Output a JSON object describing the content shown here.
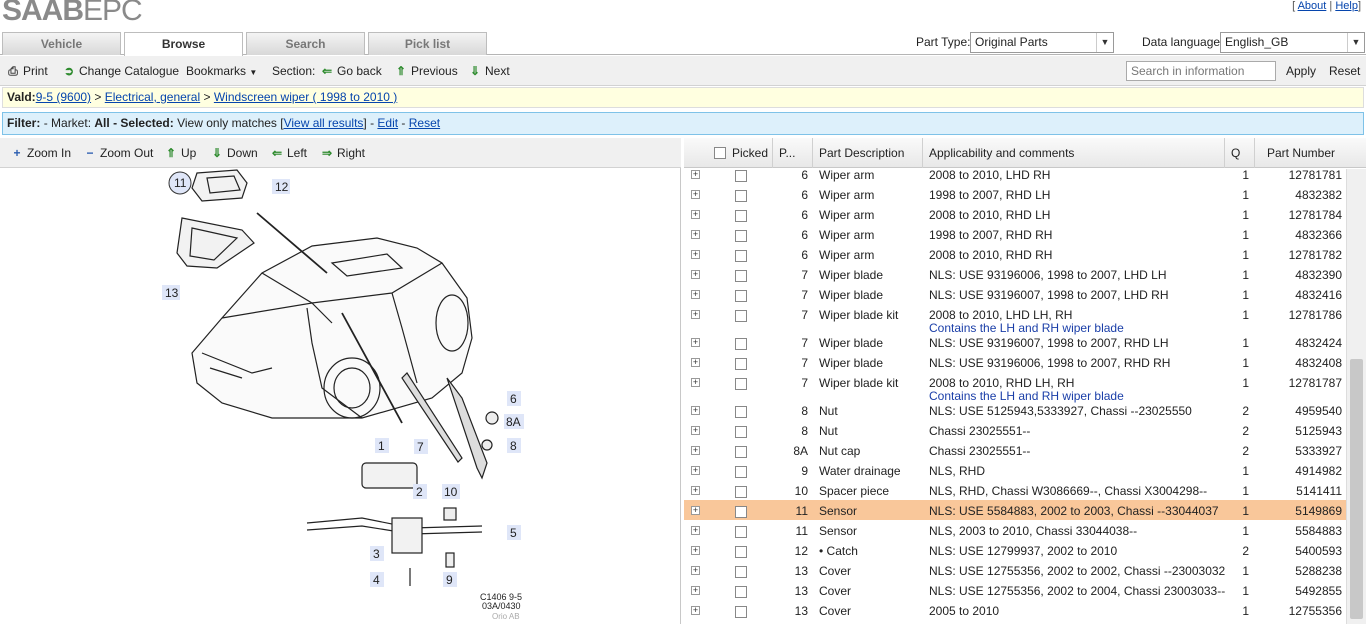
{
  "app": {
    "logo_bold": "SAAB",
    "logo_rest": "EPC"
  },
  "toplinks": {
    "about": "About",
    "help": "Help"
  },
  "tabs": [
    "Vehicle",
    "Browse",
    "Search",
    "Pick list"
  ],
  "part_type": {
    "label": "Part Type:",
    "value": "Original Parts"
  },
  "data_language": {
    "label": "Data language:",
    "value": "English_GB"
  },
  "toolbar": {
    "print": "Print",
    "change_catalogue": "Change Catalogue",
    "bookmarks": "Bookmarks",
    "section": "Section:",
    "go_back": "Go back",
    "previous": "Previous",
    "next": "Next",
    "search_placeholder": "Search in information",
    "apply": "Apply",
    "reset": "Reset"
  },
  "breadcrumb": {
    "prefix": "Vald:",
    "model": "9-5 (9600)",
    "sep": ">",
    "group": "Electrical, general",
    "section": "Windscreen wiper ( 1998 to 2010 )"
  },
  "filter": {
    "label": "Filter:",
    "market_label": "- Market:",
    "market": "All",
    "selected_label": "- Selected:",
    "selected": "View only matches",
    "view_all": "View all results",
    "edit": "Edit",
    "reset": "Reset"
  },
  "diagram_toolbar": {
    "zoom_in": "Zoom In",
    "zoom_out": "Zoom Out",
    "up": "Up",
    "down": "Down",
    "left": "Left",
    "right": "Right"
  },
  "diagram": {
    "caption_1": "C1406 9-5",
    "caption_2": "03A/0430",
    "caption_3": "Orio AB",
    "callouts": [
      "11",
      "12",
      "13",
      "6",
      "8A",
      "1",
      "7",
      "8",
      "2",
      "10",
      "5",
      "3",
      "4",
      "9"
    ]
  },
  "table": {
    "headers": {
      "picked": "Picked",
      "pos": "P...",
      "desc": "Part Description",
      "appl": "Applicability and comments",
      "qty": "Q",
      "partno": "Part Number"
    },
    "rows": [
      {
        "pos": "6",
        "desc": "Wiper arm",
        "appl": "2008 to 2010, LHD RH",
        "note": "",
        "qty": "1",
        "partno": "12781781"
      },
      {
        "pos": "6",
        "desc": "Wiper arm",
        "appl": "1998 to 2007, RHD LH",
        "note": "",
        "qty": "1",
        "partno": "4832382"
      },
      {
        "pos": "6",
        "desc": "Wiper arm",
        "appl": "2008 to 2010, RHD LH",
        "note": "",
        "qty": "1",
        "partno": "12781784"
      },
      {
        "pos": "6",
        "desc": "Wiper arm",
        "appl": "1998 to 2007, RHD RH",
        "note": "",
        "qty": "1",
        "partno": "4832366"
      },
      {
        "pos": "6",
        "desc": "Wiper arm",
        "appl": "2008 to 2010, RHD RH",
        "note": "",
        "qty": "1",
        "partno": "12781782"
      },
      {
        "pos": "7",
        "desc": "Wiper blade",
        "appl": "NLS: USE 93196006, 1998 to 2007, LHD LH",
        "note": "",
        "qty": "1",
        "partno": "4832390"
      },
      {
        "pos": "7",
        "desc": "Wiper blade",
        "appl": "NLS: USE 93196007, 1998 to 2007, LHD RH",
        "note": "",
        "qty": "1",
        "partno": "4832416"
      },
      {
        "pos": "7",
        "desc": "Wiper blade kit",
        "appl": "2008 to 2010, LHD LH, RH",
        "note": "Contains the LH and RH wiper blade",
        "qty": "1",
        "partno": "12781786"
      },
      {
        "pos": "7",
        "desc": "Wiper blade",
        "appl": "NLS: USE 93196007, 1998 to 2007, RHD LH",
        "note": "",
        "qty": "1",
        "partno": "4832424"
      },
      {
        "pos": "7",
        "desc": "Wiper blade",
        "appl": "NLS: USE 93196006, 1998 to 2007, RHD RH",
        "note": "",
        "qty": "1",
        "partno": "4832408"
      },
      {
        "pos": "7",
        "desc": "Wiper blade kit",
        "appl": "2008 to 2010, RHD LH, RH",
        "note": "Contains the LH and RH wiper blade",
        "qty": "1",
        "partno": "12781787"
      },
      {
        "pos": "8",
        "desc": "Nut",
        "appl": "NLS: USE 5125943,5333927, Chassi --23025550",
        "note": "",
        "qty": "2",
        "partno": "4959540"
      },
      {
        "pos": "8",
        "desc": "Nut",
        "appl": "Chassi 23025551--",
        "note": "",
        "qty": "2",
        "partno": "5125943"
      },
      {
        "pos": "8A",
        "desc": "Nut cap",
        "appl": "Chassi 23025551--",
        "note": "",
        "qty": "2",
        "partno": "5333927"
      },
      {
        "pos": "9",
        "desc": "Water drainage",
        "appl": "NLS, RHD",
        "note": "",
        "qty": "1",
        "partno": "4914982"
      },
      {
        "pos": "10",
        "desc": "Spacer piece",
        "appl": "NLS, RHD, Chassi W3086669--, Chassi X3004298--",
        "note": "",
        "qty": "1",
        "partno": "5141411"
      },
      {
        "pos": "11",
        "desc": "Sensor",
        "appl": "NLS: USE 5584883, 2002 to 2003, Chassi --33044037",
        "note": "",
        "qty": "1",
        "partno": "5149869",
        "highlight": true
      },
      {
        "pos": "11",
        "desc": "Sensor",
        "appl": "NLS, 2003 to 2010, Chassi 33044038--",
        "note": "",
        "qty": "1",
        "partno": "5584883"
      },
      {
        "pos": "12",
        "desc": "• Catch",
        "appl": "NLS: USE 12799937, 2002 to 2010",
        "note": "",
        "qty": "2",
        "partno": "5400593"
      },
      {
        "pos": "13",
        "desc": "Cover",
        "appl": "NLS: USE 12755356, 2002 to 2002, Chassi --23003032",
        "note": "",
        "qty": "1",
        "partno": "5288238"
      },
      {
        "pos": "13",
        "desc": "Cover",
        "appl": "NLS: USE 12755356, 2002 to 2004, Chassi 23003033--",
        "note": "",
        "qty": "1",
        "partno": "5492855"
      },
      {
        "pos": "13",
        "desc": "Cover",
        "appl": "2005 to 2010",
        "note": "",
        "qty": "1",
        "partno": "12755356"
      }
    ]
  }
}
